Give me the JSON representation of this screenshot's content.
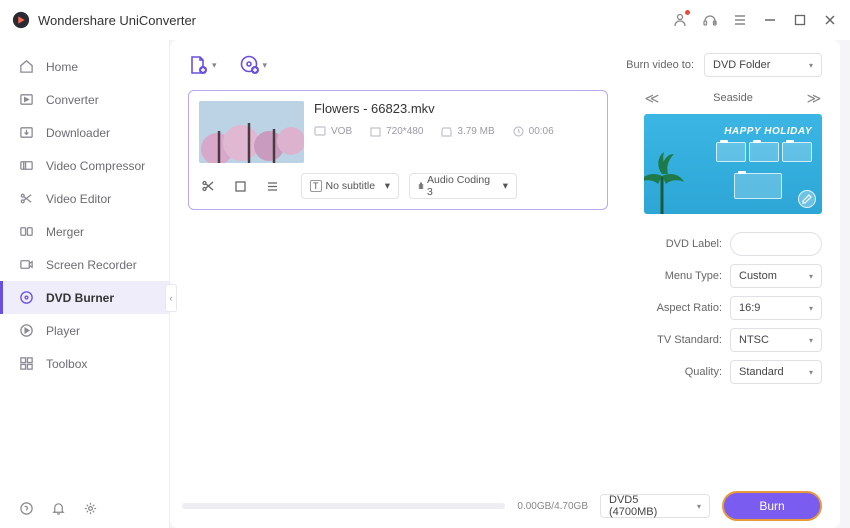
{
  "app": {
    "title": "Wondershare UniConverter"
  },
  "sidebar": {
    "items": [
      {
        "label": "Home"
      },
      {
        "label": "Converter"
      },
      {
        "label": "Downloader"
      },
      {
        "label": "Video Compressor"
      },
      {
        "label": "Video Editor"
      },
      {
        "label": "Merger"
      },
      {
        "label": "Screen Recorder"
      },
      {
        "label": "DVD Burner"
      },
      {
        "label": "Player"
      },
      {
        "label": "Toolbox"
      }
    ]
  },
  "toolbar": {
    "burn_to_label": "Burn video to:",
    "burn_to_value": "DVD Folder"
  },
  "file": {
    "name": "Flowers - 66823.mkv",
    "format": "VOB",
    "resolution": "720*480",
    "size": "3.79 MB",
    "duration": "00:06",
    "subtitle": "No subtitle",
    "audio": "Audio Coding 3"
  },
  "template": {
    "name": "Seaside",
    "banner": "HAPPY HOLIDAY"
  },
  "form": {
    "dvd_label_label": "DVD Label:",
    "dvd_label_value": "",
    "menu_type_label": "Menu Type:",
    "menu_type_value": "Custom",
    "aspect_label": "Aspect Ratio:",
    "aspect_value": "16:9",
    "tv_label": "TV Standard:",
    "tv_value": "NTSC",
    "quality_label": "Quality:",
    "quality_value": "Standard"
  },
  "footer": {
    "progress_text": "0.00GB/4.70GB",
    "disc_value": "DVD5 (4700MB)",
    "burn_label": "Burn"
  }
}
